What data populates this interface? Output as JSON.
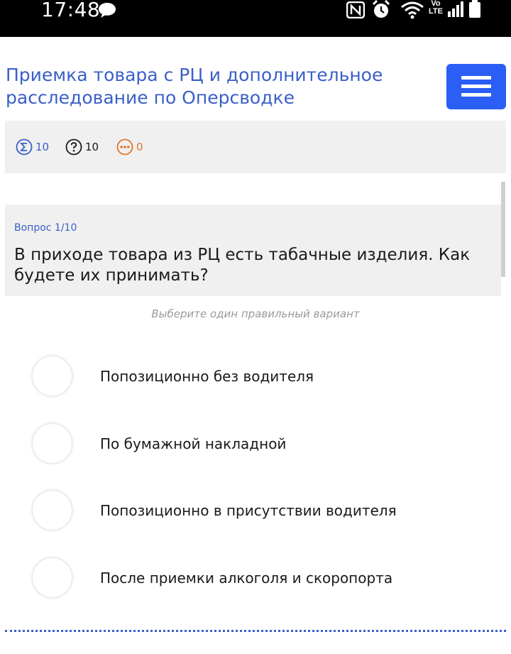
{
  "status_bar": {
    "time": "17:48",
    "network_label_top": "Vo",
    "network_label_bottom": "LTE"
  },
  "header": {
    "title": " Приемка товара с РЦ и дополнительное расследование по Оперсводке"
  },
  "stats": {
    "total": "10",
    "questions": "10",
    "pending": "0"
  },
  "question": {
    "number_label": "Вопрос 1/10",
    "text": "В приходе товара из РЦ есть табачные изделия. Как будете их принимать?",
    "instruction": "Выберите один правильный вариант"
  },
  "options": [
    {
      "label": "Попозиционно без водителя"
    },
    {
      "label": "По бумажной накладной"
    },
    {
      "label": "Попозиционно в присутствии водителя"
    },
    {
      "label": "После приемки алкоголя и скоропорта"
    }
  ],
  "colors": {
    "accent": "#3a5fc8",
    "menu_button": "#2a5ef5",
    "pending": "#e0762b",
    "panel_bg": "#f0f0f0"
  }
}
